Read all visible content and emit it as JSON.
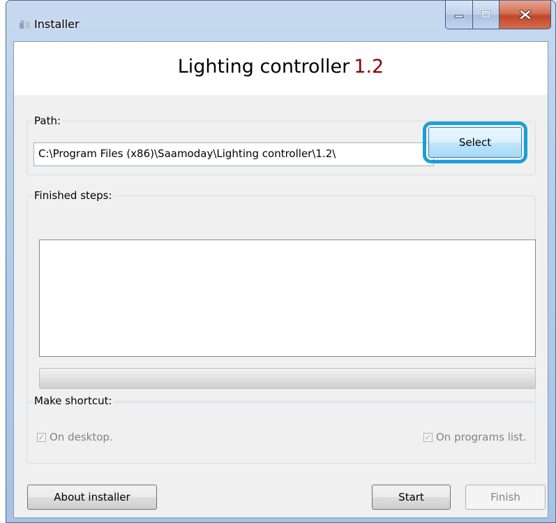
{
  "window": {
    "title": "Installer",
    "controls": {
      "minimize": "minimize-icon",
      "maximize": "maximize-icon",
      "close": "close-icon"
    }
  },
  "header": {
    "app_name": "Lighting controller",
    "version": "1.2",
    "version_color": "#8a0000"
  },
  "path_group": {
    "label": "Path:",
    "value": "C:\\Program Files (x86)\\Saamoday\\Lighting controller\\1.2\\",
    "select_label": "Select",
    "highlight_color": "#1a9fd8"
  },
  "steps_group": {
    "label": "Finished steps:",
    "items": [],
    "progress": 0
  },
  "shortcut_group": {
    "label": "Make shortcut:",
    "desktop": {
      "label": "On desktop.",
      "checked": true,
      "enabled": false
    },
    "programs": {
      "label": "On programs list.",
      "checked": true,
      "enabled": false
    }
  },
  "footer": {
    "about_label": "About installer",
    "start_label": "Start",
    "finish_label": "Finish"
  }
}
